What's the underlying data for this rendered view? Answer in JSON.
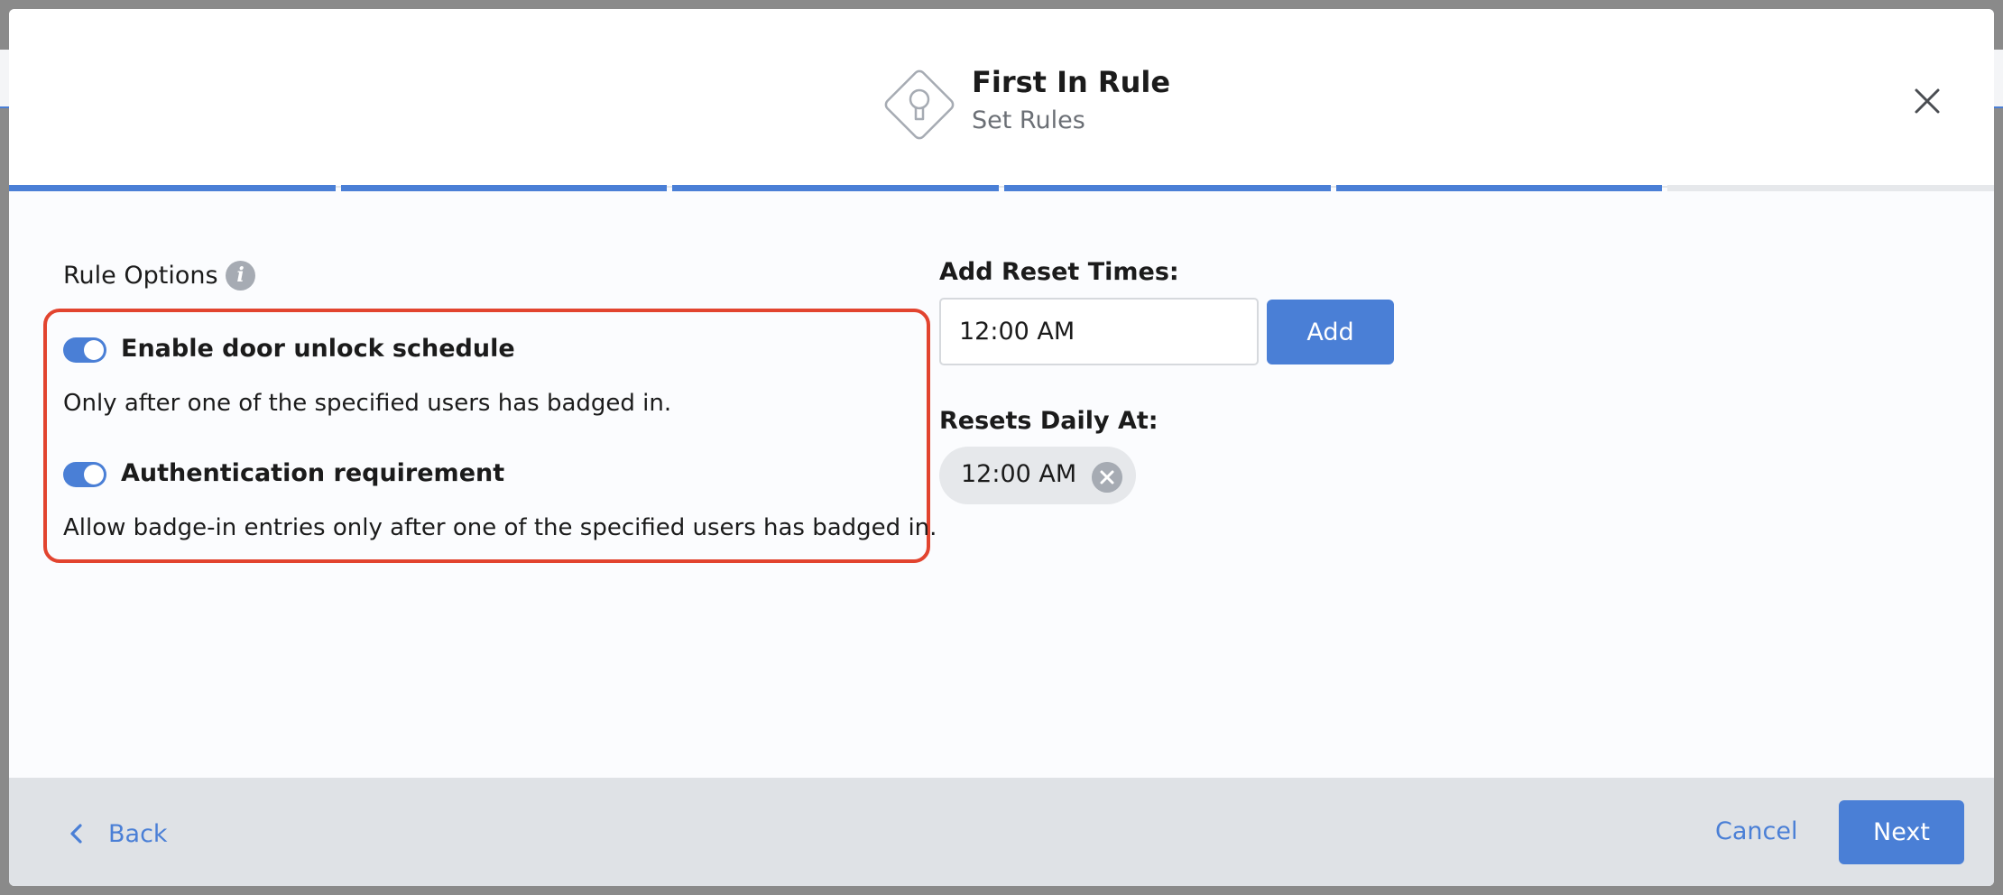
{
  "colors": {
    "accent": "#4a7fd6",
    "highlight": "#e2442f",
    "footer_bg": "#dfe2e6",
    "chip_bg": "#e6e8eb"
  },
  "header": {
    "title": "First In Rule",
    "subtitle": "Set Rules",
    "logo_icon": "keyhole-diamond-icon",
    "close_icon": "close-icon"
  },
  "progress": {
    "steps_total": 6,
    "steps_completed": 5
  },
  "rule_options": {
    "label": "Rule Options",
    "info_icon": "info-icon",
    "info_glyph": "i",
    "options": [
      {
        "label": "Enable door unlock schedule",
        "enabled": true,
        "description": "Only after one of the specified users has badged in."
      },
      {
        "label": "Authentication requirement",
        "enabled": true,
        "description": "Allow badge-in entries only after one of the specified users has badged in."
      }
    ]
  },
  "reset_times": {
    "label": "Add Reset Times:",
    "input_value": "12:00 AM",
    "add_label": "Add",
    "daily_label": "Resets Daily At:",
    "chips": [
      {
        "time": "12:00 AM",
        "remove_icon": "close-circle-icon"
      }
    ]
  },
  "footer": {
    "back_label": "Back",
    "back_icon": "chevron-left-icon",
    "cancel_label": "Cancel",
    "next_label": "Next"
  }
}
